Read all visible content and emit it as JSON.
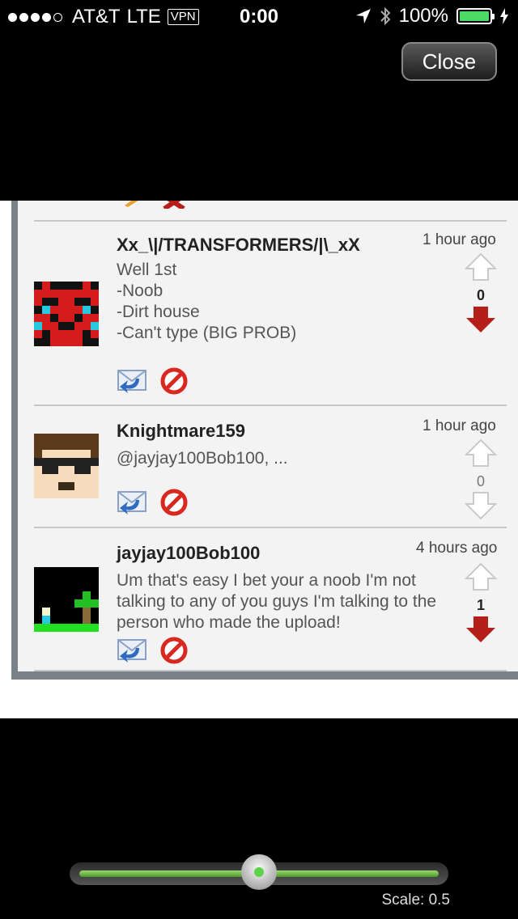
{
  "status_bar": {
    "carrier": "AT&T",
    "network": "LTE",
    "vpn": "VPN",
    "time": "0:00",
    "battery": "100%"
  },
  "toolbar": {
    "close_label": "Close"
  },
  "comments": [
    {
      "username": "Xx_\\|/TRANSFORMERS/|\\_xX",
      "time": "1 hour ago",
      "body": "Well 1st\n-Noob\n-Dirt house\n-Can't type (BIG PROB)",
      "score": "0",
      "vote": "down"
    },
    {
      "username": "Knightmare159",
      "time": "1 hour ago",
      "body": "@jayjay100Bob100, ...",
      "score": "0",
      "vote": "none"
    },
    {
      "username": "jayjay100Bob100",
      "time": "4 hours ago",
      "body": "Um that's easy I bet your a noob I'm not talking to any of you guys I'm talking to the person who made the upload!",
      "score": "1",
      "vote": "down"
    }
  ],
  "zoom": {
    "scale_label": "Scale: 0.5",
    "level": 0.5
  },
  "colors": {
    "downvote": "#b51f1a",
    "battery": "#4cd964",
    "slider": "#6fc040"
  }
}
